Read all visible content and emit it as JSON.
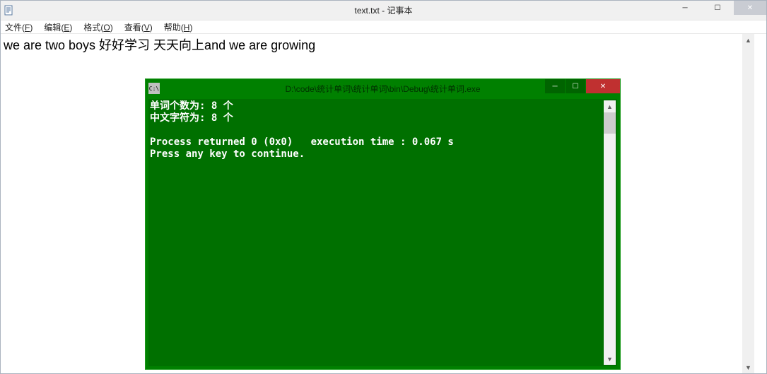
{
  "notepad": {
    "title": "text.txt - 记事本",
    "menus": {
      "file": {
        "label": "文件",
        "key": "F"
      },
      "edit": {
        "label": "编辑",
        "key": "E"
      },
      "format": {
        "label": "格式",
        "key": "O"
      },
      "view": {
        "label": "查看",
        "key": "V"
      },
      "help": {
        "label": "帮助",
        "key": "H"
      }
    },
    "content": "we are two boys 好好学习 天天向上and we are growing",
    "win_controls": {
      "minimize": "─",
      "maximize": "☐",
      "close": "✕"
    },
    "scroll": {
      "up": "▲",
      "down": "▼"
    }
  },
  "console": {
    "title": "D:\\code\\统计单词\\统计单词\\bin\\Debug\\统计单词.exe",
    "lines": {
      "l1": "单词个数为: 8 个",
      "l2": "中文字符为: 8 个",
      "l3": "",
      "l4": "Process returned 0 (0x0)   execution time : 0.067 s",
      "l5": "Press any key to continue."
    },
    "icon_text": "C:\\",
    "win_controls": {
      "minimize": "─",
      "maximize": "☐",
      "close": "✕"
    },
    "scroll": {
      "up": "▲",
      "down": "▼"
    }
  }
}
